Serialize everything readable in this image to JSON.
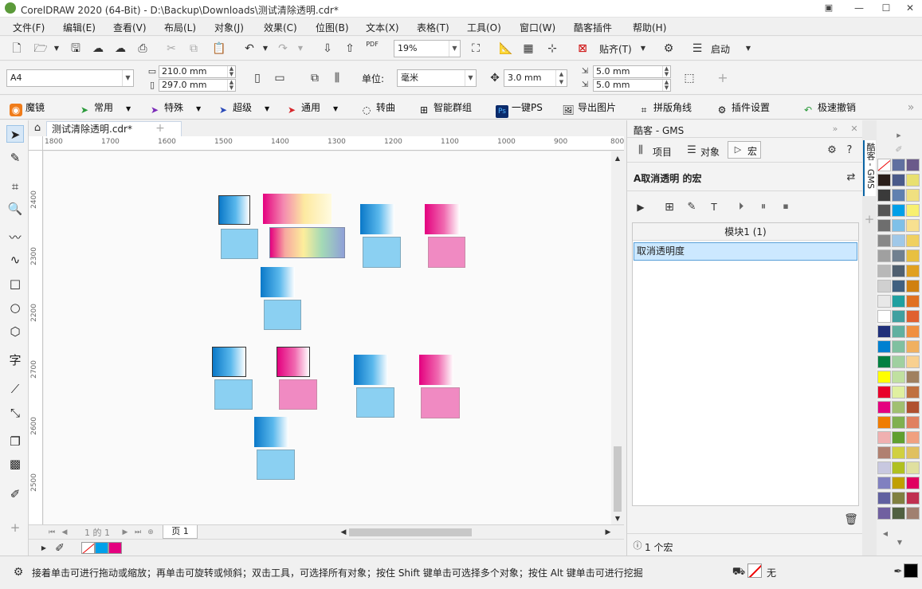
{
  "window": {
    "title": "CorelDRAW 2020 (64-Bit) - D:\\Backup\\Downloads\\测试清除透明.cdr*"
  },
  "menu": [
    "文件(F)",
    "编辑(E)",
    "查看(V)",
    "布局(L)",
    "对象(J)",
    "效果(C)",
    "位图(B)",
    "文本(X)",
    "表格(T)",
    "工具(O)",
    "窗口(W)",
    "酷客插件",
    "帮助(H)"
  ],
  "toolbar": {
    "zoom": "19%",
    "snap_label": "贴齐(T)",
    "launch_label": "启动"
  },
  "props": {
    "page_size": "A4",
    "width": "210.0 mm",
    "height": "297.0 mm",
    "unit_label": "单位:",
    "unit_value": "毫米",
    "nudge": "3.0 mm",
    "dup_x": "5.0 mm",
    "dup_y": "5.0 mm"
  },
  "plugins": [
    "魔镜",
    "常用",
    "特殊",
    "超级",
    "通用",
    "转曲",
    "智能群组",
    "一键PS",
    "导出图片",
    "拼版角线",
    "插件设置",
    "极速撤销"
  ],
  "document": {
    "tab": "测试清除透明.cdr*",
    "hruler_ticks": [
      "1800",
      "1700",
      "1600",
      "1500",
      "1400",
      "1300",
      "1200",
      "1100",
      "1000",
      "900",
      "800"
    ],
    "vruler_ticks": [
      "2400",
      "2300",
      "2200",
      "2700",
      "2600",
      "2500",
      "2400"
    ],
    "page_counter": "1 的 1",
    "page_tab": "页 1"
  },
  "docker": {
    "title": "酷客 - GMS",
    "tab_project": "项目",
    "tab_object": "对象",
    "tab_macro": "宏",
    "heading": "A取消透明 的宏",
    "module": "模块1 (1)",
    "macro_item": "取消透明度",
    "footer": "1 个宏",
    "side_tab": "酷客 - GMS"
  },
  "status": {
    "hint": "接着单击可进行拖动或缩放；再单击可旋转或倾斜；双击工具，可选择所有对象；按住 Shift 键单击可选择多个对象；按住 Alt 键单击可进行挖掘",
    "fill_label": "无"
  },
  "colors": {
    "accent": "#0a64a4",
    "selected": "#cce8ff",
    "cyan": "#00a0e9",
    "magenta": "#e4007f"
  }
}
